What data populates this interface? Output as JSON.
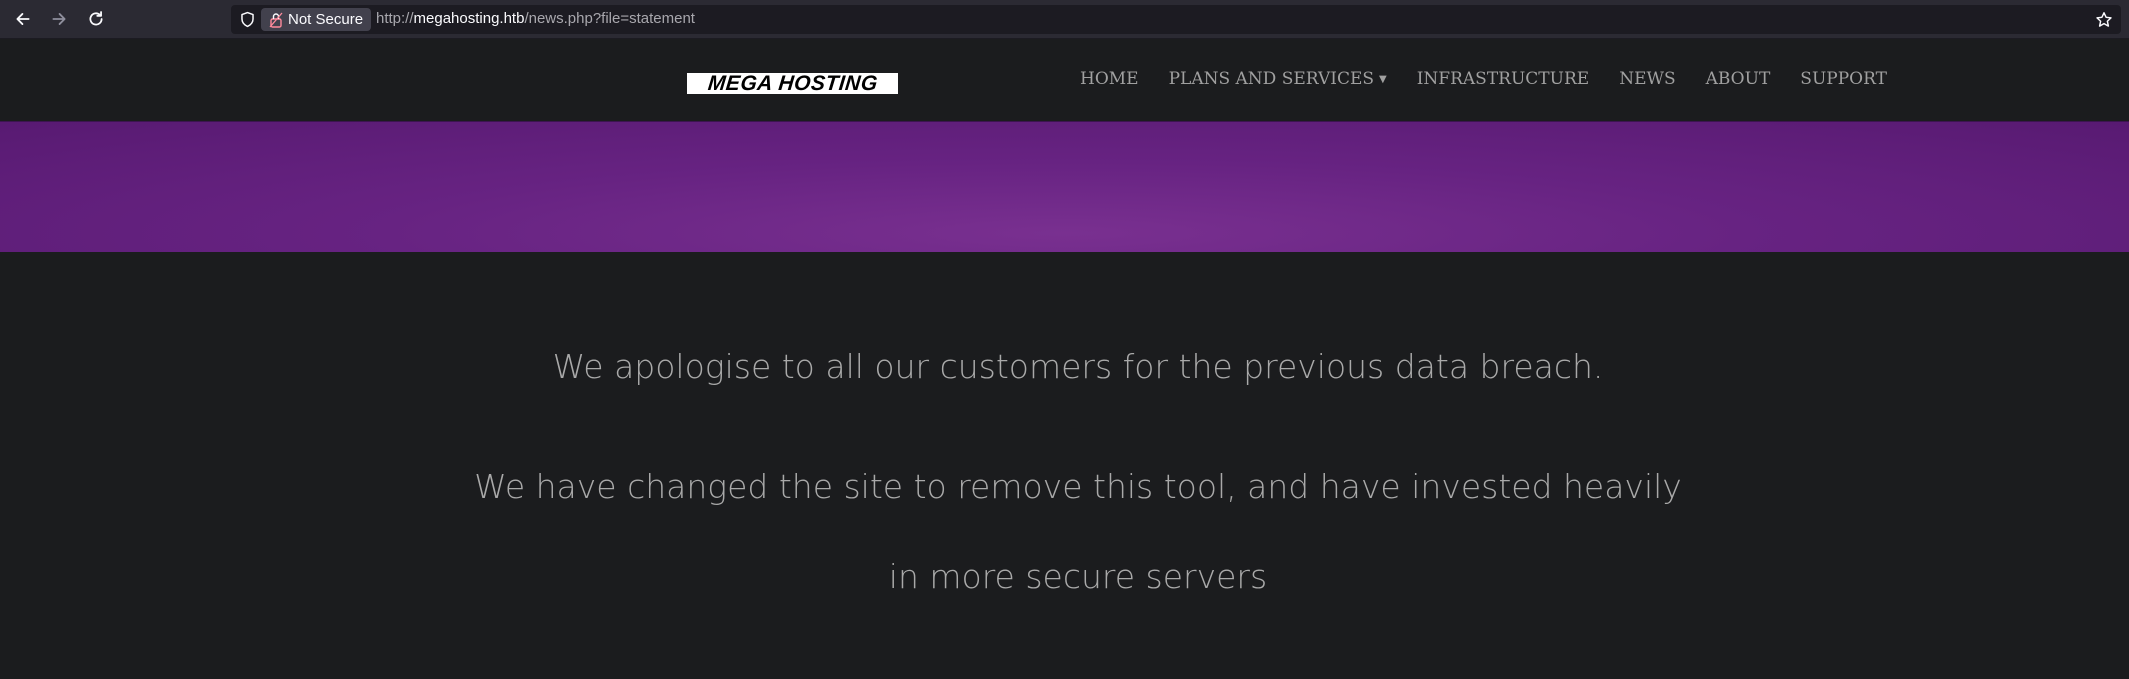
{
  "browser": {
    "security_label": "Not Secure",
    "url_scheme": "http://",
    "url_host": "megahosting.htb",
    "url_path": "/news.php?file=statement",
    "icons": [
      "back-icon",
      "forward-icon",
      "reload-icon",
      "shield-icon",
      "lock-icon",
      "star-icon"
    ]
  },
  "site": {
    "logo_text": "MEGA HOSTING",
    "menu": [
      {
        "label": "HOME"
      },
      {
        "label": "PLANS AND SERVICES",
        "has_dropdown": true
      },
      {
        "label": "INFRASTRUCTURE"
      },
      {
        "label": "NEWS"
      },
      {
        "label": "ABOUT"
      },
      {
        "label": "SUPPORT"
      }
    ],
    "hero_color": "#672382"
  },
  "content": {
    "line1": "We apologise to all our customers for the previous data breach.",
    "line2": "We have changed the site to remove this tool, and have invested heavily",
    "line3": "in more secure servers"
  }
}
